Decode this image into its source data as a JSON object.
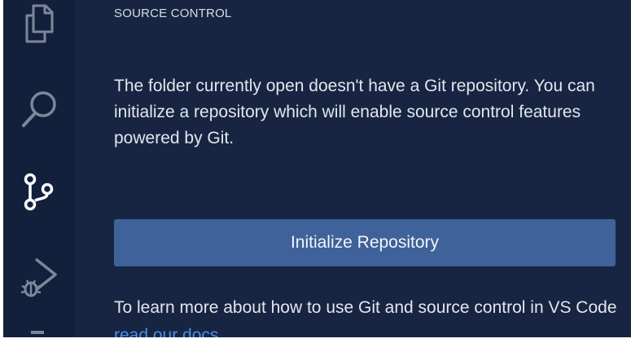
{
  "sidebar": {
    "title": "SOURCE CONTROL",
    "message": "The folder currently open doesn't have a Git repository. You can initialize a repository which will enable source control features powered by Git.",
    "init_button_label": "Initialize Repository",
    "learn_more_prefix": "To learn more about how to use Git and source control in VS Code ",
    "learn_more_link": "read our docs"
  },
  "activity_bar": {
    "items": [
      {
        "icon": "files-icon",
        "active": false
      },
      {
        "icon": "search-icon",
        "active": false
      },
      {
        "icon": "source-control-icon",
        "active": true
      },
      {
        "icon": "run-debug-icon",
        "active": false
      },
      {
        "icon": "extensions-icon",
        "active": false
      }
    ]
  },
  "colors": {
    "activity_bar_bg": "#13203c",
    "sidebar_bg": "#172542",
    "button_bg": "#3e6299",
    "link": "#4a8fe8",
    "icon_inactive": "#7d879a",
    "icon_active": "#ffffff"
  }
}
